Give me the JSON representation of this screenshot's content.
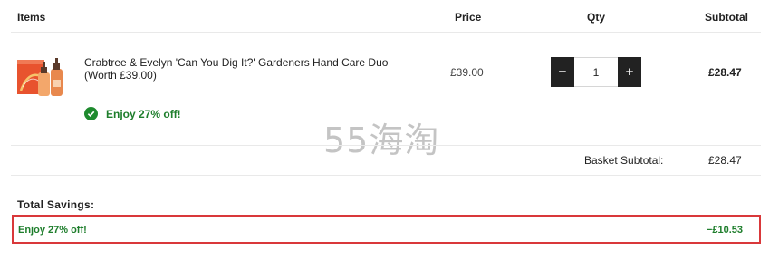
{
  "table_header": {
    "items": "Items",
    "price": "Price",
    "qty": "Qty",
    "subtotal": "Subtotal"
  },
  "line_item": {
    "name": "Crabtree & Evelyn 'Can You Dig It?' Gardeners Hand Care Duo (Worth £39.00)",
    "price": "£39.00",
    "quantity": "1",
    "subtotal": "£28.47",
    "offer": "Enjoy 27% off!",
    "decrease_symbol": "−",
    "increase_symbol": "+"
  },
  "basket": {
    "label": "Basket Subtotal:",
    "value": "£28.47"
  },
  "savings": {
    "title": "Total Savings:",
    "label": "Enjoy 27% off!",
    "value": "−£10.53"
  },
  "watermark": "55海淘",
  "colors": {
    "offer_green": "#1e7e2c",
    "highlight_red": "#d9383a",
    "button_dark": "#222222"
  }
}
